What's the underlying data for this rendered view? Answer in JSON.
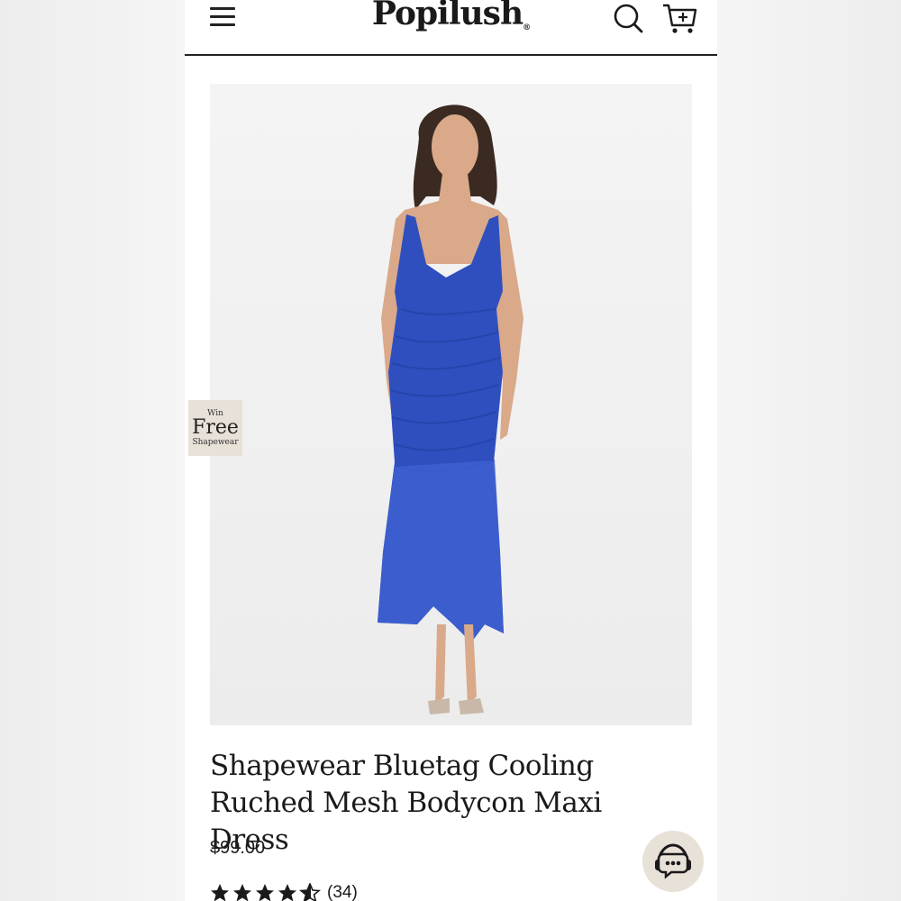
{
  "header": {
    "brand": "Popilush",
    "brand_mark": "®",
    "icons": {
      "menu": "hamburger-menu-icon",
      "search": "search-icon",
      "cart": "cart-plus-icon"
    }
  },
  "promo_badge": {
    "line1": "Win",
    "line2": "Free",
    "line3": "Shapewear"
  },
  "product": {
    "title": "Shapewear Bluetag Cooling Ruched Mesh Bodycon Maxi Dress",
    "price": "$99.00",
    "rating": 4.5,
    "review_count": "(34)",
    "dress_color": "#2f4fbf"
  },
  "chat": {
    "icon": "chat-support-icon"
  },
  "colors": {
    "accent_beige": "#e8e1d8",
    "text": "#1a1a1a",
    "header_rule": "#222222"
  }
}
